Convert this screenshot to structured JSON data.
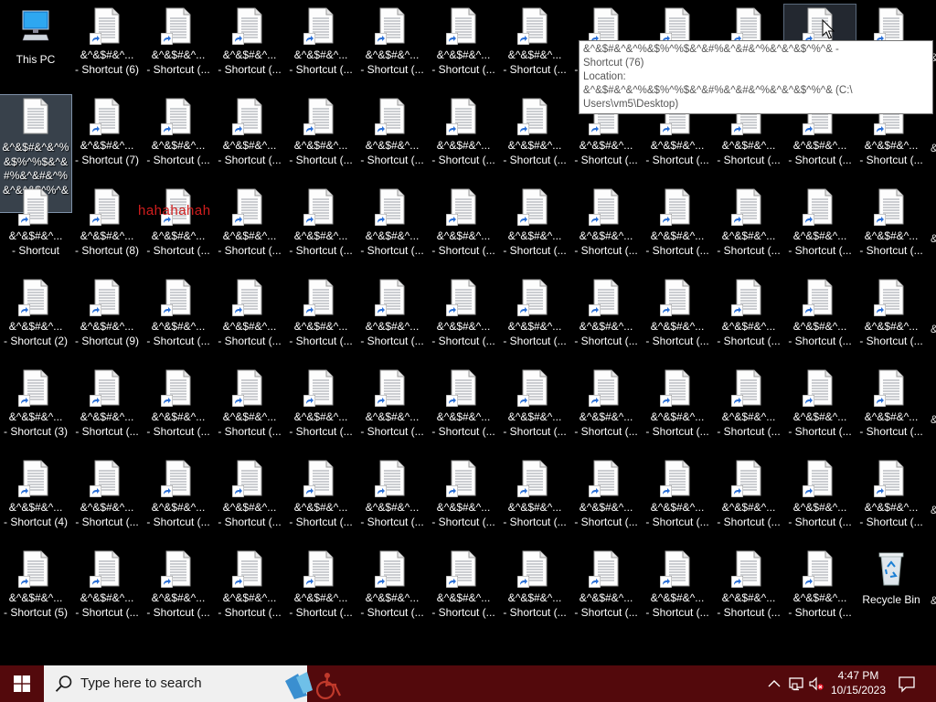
{
  "desktop": {
    "this_pc_label": "This PC",
    "recycle_bin_label": "Recycle Bin",
    "short_label_a": "&^&$#&^...",
    "short_label_b": "- Shortcut (...",
    "col0_labels": [
      "- Shortcut",
      "- Shortcut (2)",
      "- Shortcut (3)",
      "- Shortcut (4)",
      "- Shortcut (5)"
    ],
    "col1_labels": [
      "- Shortcut (6)",
      "- Shortcut (7)",
      "- Shortcut (8)",
      "- Shortcut (9)"
    ],
    "selected_label": "&^&$#&^&^%&$%^%$&^&#%&^&#&^%&^&^&$^%^&",
    "overlay_text": "hahahahah",
    "edge_marks": [
      "&",
      "&",
      "&",
      "&",
      "&",
      "&",
      "&"
    ]
  },
  "tooltip": {
    "line1": "&^&$#&^&^%&$%^%$&^&#%&^&#&^%&^&^&$^%^& -",
    "line2": "Shortcut (76)",
    "line3": "Location:",
    "line4": "&^&$#&^&^%&$%^%$&^&#%&^&#&^%&^&^&$^%^& (C:\\",
    "line5": "Users\\vm5\\Desktop)"
  },
  "taskbar": {
    "search_placeholder": "Type here to search",
    "time": "4:47 PM",
    "date": "10/15/2023"
  },
  "colors": {
    "taskbar_bg": "#53090c",
    "desktop_bg": "#000000",
    "overlay_text": "#d21e1e"
  },
  "icons": [
    "windows-start-icon",
    "search-icon",
    "search-highlight-icon",
    "chevron-up-icon",
    "network-icon",
    "volume-muted-icon",
    "notification-icon",
    "document-icon",
    "shortcut-arrow-icon",
    "this-pc-icon",
    "recycle-bin-icon",
    "mouse-cursor-icon"
  ]
}
